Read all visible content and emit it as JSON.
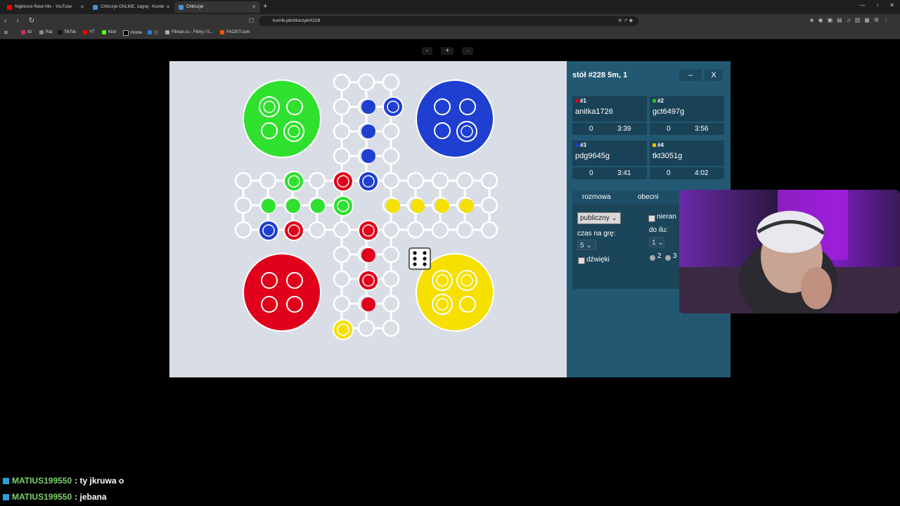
{
  "browser": {
    "tabs": [
      {
        "label": "Nightcore Rave Mix - YouTube",
        "active": false
      },
      {
        "label": "Chińczyk ONLINE, zagraj - Kurnik",
        "active": false
      },
      {
        "label": "Chińczyk",
        "active": true
      }
    ],
    "url": "kurnik.pl/chinczyk/#228",
    "bookmarks": [
      "IG",
      "Rat",
      "TikTok",
      "YT",
      "Kick",
      "Home",
      "Filman.cc - Filmy i S...",
      "FACEIT.com"
    ],
    "zoom_controls": [
      "-",
      "+",
      "·"
    ]
  },
  "game": {
    "table_title": "stół #228   5m, 1",
    "minimize_label": "–",
    "close_label": "X",
    "players": [
      {
        "num": "#1",
        "color": "#e0001b",
        "name": "anitka1726",
        "score": "0",
        "time": "3:39"
      },
      {
        "num": "#2",
        "color": "#2ec02e",
        "name": "gct6497g",
        "score": "0",
        "time": "3:56"
      },
      {
        "num": "#3",
        "color": "#1f3fd1",
        "name": "pdg9645g",
        "score": "0",
        "time": "3:41"
      },
      {
        "num": "#4",
        "color": "#e6c200",
        "name": "tkt3051g",
        "score": "0",
        "time": "4:02"
      }
    ],
    "tabs": [
      "rozmowa",
      "obecni"
    ],
    "settings": {
      "visibility": "publiczny",
      "unranked_label": "nieran",
      "time_label": "czas na grę:",
      "time_value": "5",
      "up_to_label": "do ilu:",
      "up_to_value": "1",
      "sounds_label": "dźwięki",
      "radio_2": "2",
      "radio_3": "3"
    },
    "die_value": 6
  },
  "chat": [
    {
      "user": "MATIUS199550",
      "message": ": ty jkruwa o"
    },
    {
      "user": "MATIUS199550",
      "message": ": jebana"
    }
  ],
  "colors": {
    "red": "#e0001b",
    "green": "#2fe02f",
    "blue": "#1f3fd1",
    "yellow": "#f5e000",
    "board_bg": "#d9dee6",
    "panel_bg": "#235873"
  }
}
